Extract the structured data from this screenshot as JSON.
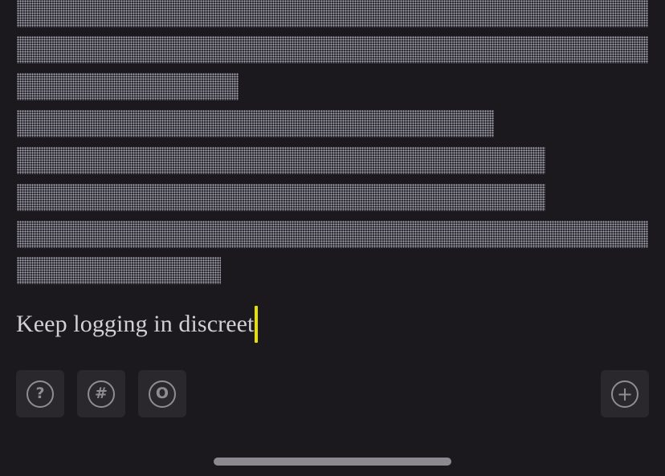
{
  "composer": {
    "text": "Keep logging in discreet",
    "caret_color": "#e6e000"
  },
  "toolbar": {
    "help_label": "?",
    "tag_label": "#",
    "circle_label": "O",
    "add_label": "+",
    "icons": [
      "question-icon",
      "hash-icon",
      "circle-o-icon",
      "plus-icon"
    ]
  },
  "colors": {
    "background": "#1b191e",
    "button_bg": "#2a282d",
    "icon_gray": "#8f8d94"
  }
}
